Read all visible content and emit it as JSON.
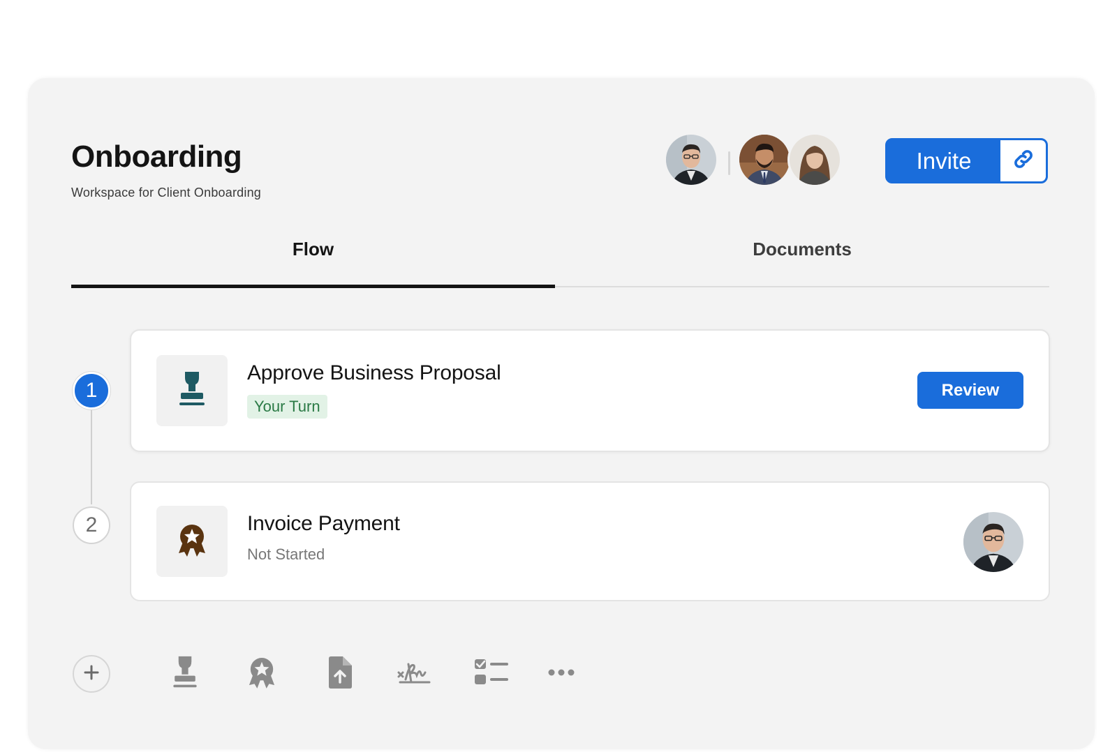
{
  "workspace": {
    "title": "Onboarding",
    "subtitle": "Workspace for Client Onboarding"
  },
  "header": {
    "invite_label": "Invite",
    "invite_link_icon": "link-icon",
    "avatars": [
      "avatar-user-1",
      "avatar-user-2",
      "avatar-user-3"
    ]
  },
  "tabs": [
    {
      "label": "Flow",
      "active": true
    },
    {
      "label": "Documents",
      "active": false
    }
  ],
  "steps": [
    {
      "number": "1",
      "title": "Approve Business Proposal",
      "status": "Your Turn",
      "icon": "stamp-icon",
      "action_label": "Review"
    },
    {
      "number": "2",
      "title": "Invoice Payment",
      "status": "Not Started",
      "icon": "award-badge-icon"
    }
  ],
  "toolbar": {
    "items": [
      "add-icon",
      "stamp-icon",
      "award-badge-icon",
      "file-upload-icon",
      "signature-icon",
      "checklist-icon",
      "more-icon"
    ]
  },
  "colors": {
    "accent": "#1a6ddb",
    "your_turn_bg": "#e2f2e6",
    "your_turn_text": "#2a7a45",
    "stamp_icon": "#1e5a63",
    "award_icon": "#5a3410",
    "toolbar_icon": "#8a8a8a"
  }
}
